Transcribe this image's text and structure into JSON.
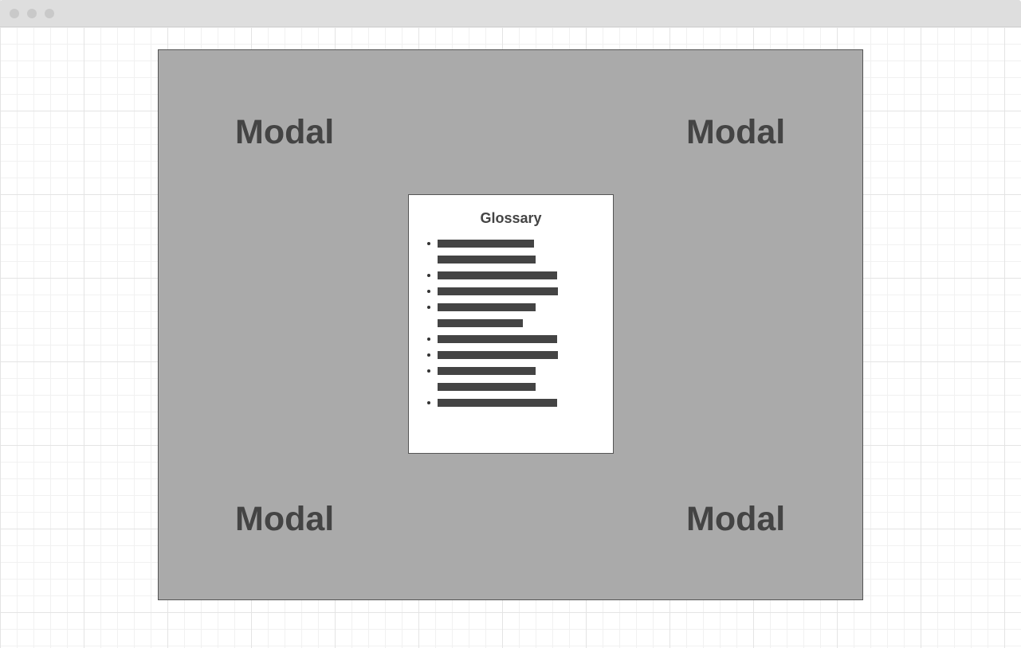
{
  "window": {
    "controls": [
      "close-dot",
      "minimize-dot",
      "maximize-dot"
    ]
  },
  "overlay": {
    "corner_labels": [
      "Modal",
      "Modal",
      "Modal",
      "Modal"
    ]
  },
  "dialog": {
    "title": "Glossary",
    "items": [
      {
        "lines": 2
      },
      {
        "lines": 1
      },
      {
        "lines": 1
      },
      {
        "lines": 2
      },
      {
        "lines": 1
      },
      {
        "lines": 1
      },
      {
        "lines": 2
      },
      {
        "lines": 1
      }
    ]
  },
  "colors": {
    "overlay": "#aaaaaa",
    "text": "#444444",
    "titlebar": "#dedede"
  }
}
